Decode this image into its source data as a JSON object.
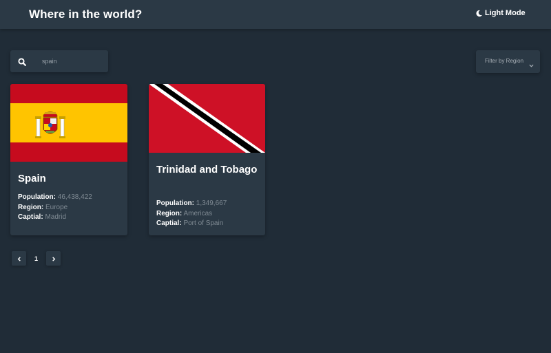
{
  "header": {
    "title": "Where in the world?",
    "theme_toggle_label": "Light Mode",
    "theme_icon": "moon-icon"
  },
  "search": {
    "value": "spain",
    "icon": "search-icon"
  },
  "filter": {
    "label": "Filter by Region",
    "icon": "chevron-down-icon"
  },
  "labels": {
    "population": "Population:",
    "region": "Region:",
    "capital": "Captial:"
  },
  "countries": [
    {
      "name": "Spain",
      "population": "46,438,422",
      "region": "Europe",
      "capital": "Madrid",
      "flag_colors": [
        "#c60b1e",
        "#ffc400"
      ]
    },
    {
      "name": "Trinidad and Tobago",
      "population": "1,349,667",
      "region": "Americas",
      "capital": "Port of Spain",
      "flag_colors": [
        "#ce1126",
        "#ffffff",
        "#000000"
      ]
    }
  ],
  "pagination": {
    "current_page": "1",
    "prev_icon": "chevron-left-icon",
    "next_icon": "chevron-right-icon"
  },
  "colors": {
    "background": "#202c37",
    "elements": "#2b3945",
    "text": "#ffffff",
    "muted_text": "#7f8a93"
  }
}
